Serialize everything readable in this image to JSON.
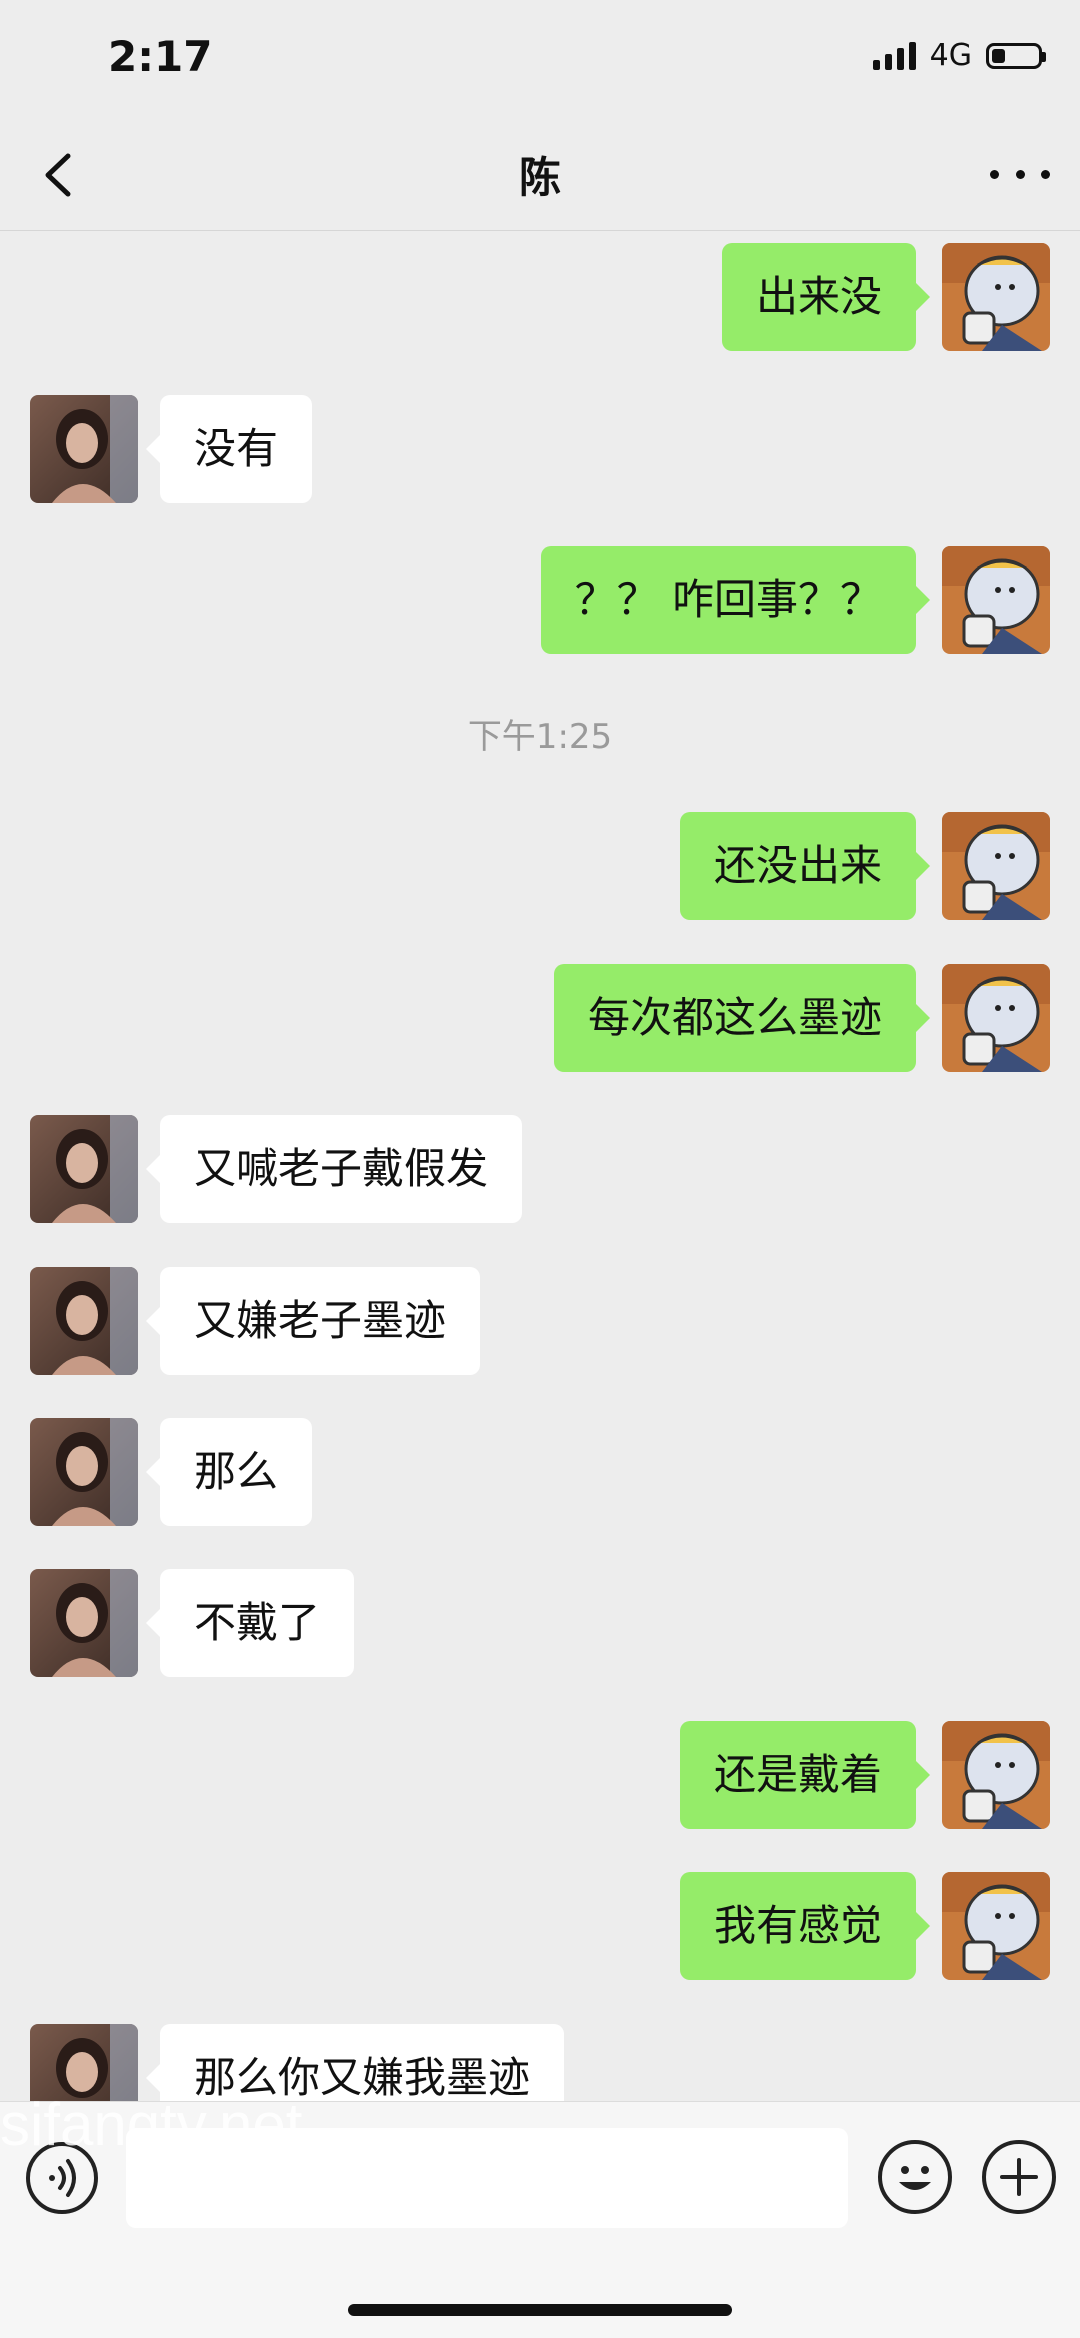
{
  "status_bar": {
    "time": "2:17",
    "network": "4G",
    "battery_level": 0.3
  },
  "nav": {
    "title": "陈",
    "back_icon": "chevron-left-icon",
    "more_icon": "more-dots-icon"
  },
  "chat": {
    "messages": [
      {
        "side": "right",
        "text": "出来没"
      },
      {
        "side": "left",
        "text": "没有"
      },
      {
        "side": "right",
        "text": "？？ 咋回事？？"
      },
      {
        "type": "timestamp",
        "text": "下午1:25"
      },
      {
        "side": "right",
        "text": "还没出来"
      },
      {
        "side": "right",
        "text": "每次都这么墨迹"
      },
      {
        "side": "left",
        "text": "又喊老子戴假发"
      },
      {
        "side": "left",
        "text": "又嫌老子墨迹"
      },
      {
        "side": "left",
        "text": "那么"
      },
      {
        "side": "left",
        "text": "不戴了"
      },
      {
        "side": "right",
        "text": "还是戴着"
      },
      {
        "side": "right",
        "text": "我有感觉"
      },
      {
        "side": "left",
        "text": "那么你又嫌我墨迹"
      }
    ]
  },
  "input_bar": {
    "voice_icon": "voice-icon",
    "input_value": "",
    "emoji_icon": "emoji-icon",
    "plus_icon": "plus-icon"
  },
  "watermark": "sifangtv.net",
  "colors": {
    "background": "#ededed",
    "sent_bubble": "#95ec69",
    "received_bubble": "#ffffff"
  }
}
